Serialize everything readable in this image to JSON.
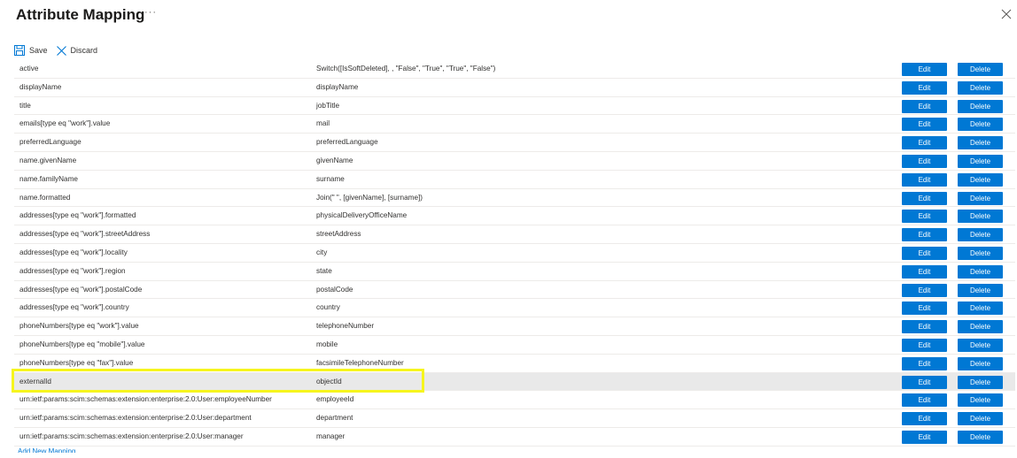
{
  "header": {
    "title": "Attribute Mapping",
    "more": "···"
  },
  "toolbar": {
    "save_label": "Save",
    "discard_label": "Discard"
  },
  "buttons": {
    "edit_label": "Edit",
    "delete_label": "Delete"
  },
  "colors": {
    "accent": "#0078d4",
    "highlight": "#f6f51e"
  },
  "rows": [
    {
      "target": "active",
      "source": "Switch([IsSoftDeleted], , \"False\", \"True\", \"True\", \"False\")"
    },
    {
      "target": "displayName",
      "source": "displayName"
    },
    {
      "target": "title",
      "source": "jobTitle"
    },
    {
      "target": "emails[type eq \"work\"].value",
      "source": "mail"
    },
    {
      "target": "preferredLanguage",
      "source": "preferredLanguage"
    },
    {
      "target": "name.givenName",
      "source": "givenName"
    },
    {
      "target": "name.familyName",
      "source": "surname"
    },
    {
      "target": "name.formatted",
      "source": "Join(\" \", [givenName], [surname])"
    },
    {
      "target": "addresses[type eq \"work\"].formatted",
      "source": "physicalDeliveryOfficeName"
    },
    {
      "target": "addresses[type eq \"work\"].streetAddress",
      "source": "streetAddress"
    },
    {
      "target": "addresses[type eq \"work\"].locality",
      "source": "city"
    },
    {
      "target": "addresses[type eq \"work\"].region",
      "source": "state"
    },
    {
      "target": "addresses[type eq \"work\"].postalCode",
      "source": "postalCode"
    },
    {
      "target": "addresses[type eq \"work\"].country",
      "source": "country"
    },
    {
      "target": "phoneNumbers[type eq \"work\"].value",
      "source": "telephoneNumber"
    },
    {
      "target": "phoneNumbers[type eq \"mobile\"].value",
      "source": "mobile"
    },
    {
      "target": "phoneNumbers[type eq \"fax\"].value",
      "source": "facsimileTelephoneNumber"
    },
    {
      "target": "externalId",
      "source": "objectId",
      "highlighted": true
    },
    {
      "target": "urn:ietf:params:scim:schemas:extension:enterprise:2.0:User:employeeNumber",
      "source": "employeeId"
    },
    {
      "target": "urn:ietf:params:scim:schemas:extension:enterprise:2.0:User:department",
      "source": "department"
    },
    {
      "target": "urn:ietf:params:scim:schemas:extension:enterprise:2.0:User:manager",
      "source": "manager"
    }
  ],
  "footer": {
    "add_mapping_label": "Add New Mapping"
  }
}
